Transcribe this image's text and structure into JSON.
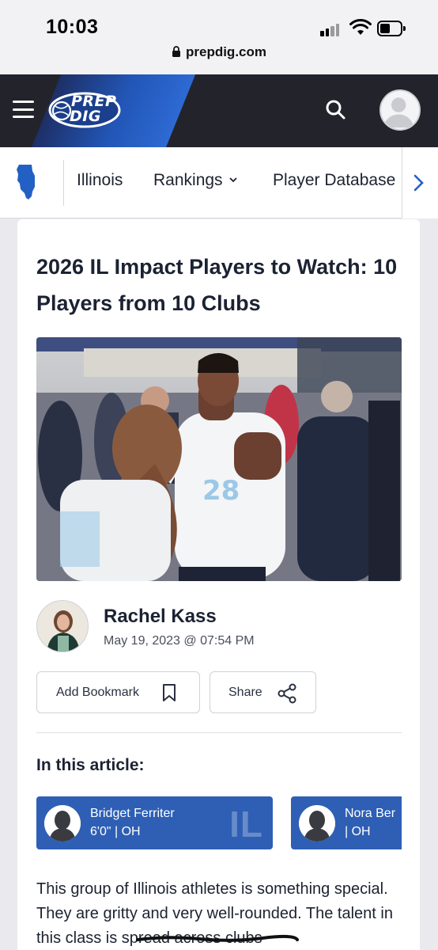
{
  "status_bar": {
    "time": "10:03"
  },
  "browser": {
    "url": "prepdig.com"
  },
  "header": {
    "logo_line1": "PREP",
    "logo_line2": "DIG"
  },
  "subnav": {
    "state": "Illinois",
    "rankings": "Rankings",
    "player_database": "Player Database"
  },
  "article": {
    "title": "2026 IL Impact Players to Watch: 10 Players from 10 Clubs",
    "photo_jersey_number": "28",
    "author": "Rachel Kass",
    "date": "May 19, 2023 @ 07:54 PM",
    "bookmark_label": "Add Bookmark",
    "share_label": "Share",
    "in_this_article": "In this article:",
    "players": [
      {
        "name": "Bridget Ferriter",
        "info": "6'0\" | OH",
        "state": "IL"
      },
      {
        "name": "Nora Ber",
        "info": "| OH"
      }
    ],
    "body": "This group of Illinois athletes is something special. They are gritty and very well-rounded. The talent in this class is spread across clubs"
  },
  "colors": {
    "nav_dark": "#23242b",
    "brand_blue": "#2256b7",
    "player_card_blue": "#2e5fb5"
  }
}
